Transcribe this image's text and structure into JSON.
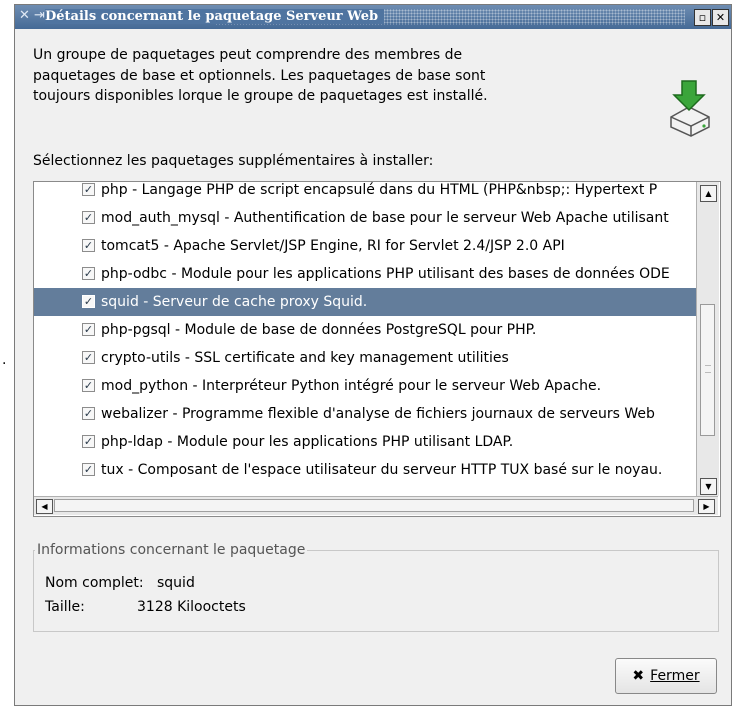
{
  "window": {
    "title": "Détails concernant le paquetage Serveur Web",
    "wm_icons": "✕ ⇥",
    "buttons": {
      "minimize": "▫",
      "close": "✕"
    }
  },
  "outside_mark": ".",
  "description": "Un groupe de paquetages peut comprendre des membres de paquetages de base et optionnels. Les paquetages de base sont toujours disponibles lorque le groupe de paquetages est installé.",
  "select_label": "Sélectionnez les paquetages supplémentaires à installer:",
  "packages": [
    {
      "label": "php - Langage PHP de script encapsulé dans du HTML (PHP&nbsp;: Hypertext P",
      "checked": true,
      "selected": false
    },
    {
      "label": "mod_auth_mysql - Authentification de base pour le serveur Web Apache utilisant",
      "checked": true,
      "selected": false
    },
    {
      "label": "tomcat5 - Apache Servlet/JSP Engine, RI for Servlet 2.4/JSP 2.0 API",
      "checked": true,
      "selected": false
    },
    {
      "label": "php-odbc - Module pour les applications PHP utilisant des bases de données ODE",
      "checked": true,
      "selected": false
    },
    {
      "label": "squid - Serveur de cache proxy Squid.",
      "checked": true,
      "selected": true
    },
    {
      "label": "php-pgsql - Module de base de données PostgreSQL pour PHP.",
      "checked": true,
      "selected": false
    },
    {
      "label": "crypto-utils - SSL certificate and key management utilities",
      "checked": true,
      "selected": false
    },
    {
      "label": "mod_python - Interpréteur Python intégré pour le serveur Web Apache.",
      "checked": true,
      "selected": false
    },
    {
      "label": "webalizer - Programme flexible d'analyse de fichiers journaux de serveurs Web",
      "checked": true,
      "selected": false
    },
    {
      "label": "php-ldap - Module pour les applications PHP utilisant LDAP.",
      "checked": true,
      "selected": false
    },
    {
      "label": "tux - Composant de l'espace utilisateur du serveur HTTP TUX basé sur le noyau.",
      "checked": true,
      "selected": false
    }
  ],
  "scroll": {
    "up": "▲",
    "down": "▼",
    "left": "◀",
    "right": "▶"
  },
  "info": {
    "legend": "Informations concernant le paquetage",
    "nom_label": "Nom complet:",
    "nom_value": "squid",
    "taille_label": "Taille:",
    "taille_value": "3128 Kilooctets"
  },
  "close_button": {
    "icon": "✖",
    "label": "Fermer"
  },
  "colors": {
    "titlebar": "#4f74a0",
    "selection": "#637d9b",
    "icon_arrow": "#3aa53a"
  }
}
